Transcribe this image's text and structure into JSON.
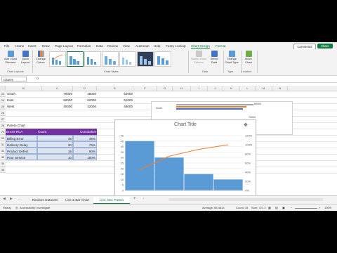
{
  "ribbon": {
    "tabs": [
      "File",
      "Home",
      "Insert",
      "Draw",
      "Page Layout",
      "Formulas",
      "Data",
      "Review",
      "View",
      "Automate",
      "Help",
      "Fuzzy Lookup",
      "Chart Design",
      "Format"
    ],
    "comments_label": "Comments",
    "share_label": "Share",
    "buttons": {
      "add_chart_element": "Add Chart Element",
      "quick_layout": "Quick Layout",
      "change_colors": "Change Colors",
      "switch_row_col": "Switch Row/ Column",
      "select_data": "Select Data",
      "change_chart_type": "Change Chart Type",
      "move_chart": "Move Chart"
    },
    "groups": {
      "chart_layouts": "Chart Layouts",
      "chart_styles": "Chart Styles",
      "data": "Data",
      "type": "Type",
      "location": "Location"
    }
  },
  "formula_bar": {
    "name_box": "Chart 5",
    "fx": "fx",
    "value": ""
  },
  "columns": [
    "B",
    "C",
    "D",
    "E",
    "F",
    "G",
    "H",
    "I",
    "J",
    "K",
    "L",
    "M",
    "N"
  ],
  "rows": {
    "numbers": [
      "23",
      "24",
      "25",
      "26",
      "27",
      "28",
      "29",
      "30",
      "31",
      "32",
      "33",
      "34",
      "35"
    ],
    "region_rows": [
      {
        "label": "South",
        "c": "70000",
        "d": "48000",
        "e": "52000"
      },
      {
        "label": "East",
        "c": "60000",
        "d": "62000",
        "e": "61000"
      },
      {
        "label": "West",
        "c": "40000",
        "d": "42000",
        "e": "48000"
      }
    ],
    "pareto_title": "Pareto Chart",
    "table_headers": {
      "col1": "Errors RCA",
      "col2": "Count",
      "col3": "Cumulative"
    },
    "table_rows": [
      {
        "label": "Billing Error",
        "count": "45",
        "cum": "45%"
      },
      {
        "label": "Delivery Delay",
        "count": "30",
        "cum": "75%"
      },
      {
        "label": "Product Defect",
        "count": "15",
        "cum": "90%"
      },
      {
        "label": "Poor Service",
        "count": "10",
        "cum": "100%"
      }
    ]
  },
  "background_chart": {
    "label_row": "North",
    "value": "60000",
    "axis_label": "70000"
  },
  "chart_data": {
    "type": "bar",
    "title": "Chart Title",
    "categories": [
      "Billing Error",
      "Delivery Delay",
      "Product Defect",
      "Poor Service"
    ],
    "series": [
      {
        "values": [
          45,
          30,
          15,
          10
        ]
      },
      {
        "type": "line",
        "values": [
          45,
          75,
          90,
          100
        ]
      }
    ],
    "y_left_ticks": [
      "50",
      "45",
      "40",
      "35",
      "30",
      "25",
      "20",
      "15",
      "10",
      "5",
      "0"
    ],
    "y_right_ticks": [
      "120%",
      "100%",
      "80%",
      "60%",
      "40%",
      "20%",
      "0%"
    ],
    "ylim": [
      0,
      50
    ],
    "y2lim": [
      0,
      120
    ],
    "colors": {
      "bar": "#5b9bd5",
      "line": "#ed7d31"
    }
  },
  "sheets": [
    "Random Datasets",
    "Line & Bar Chart",
    "Line, Bar, Pareto"
  ],
  "status": {
    "ready": "Ready",
    "accessibility": "Accessibility: Investigate",
    "average": "Average: 55.4813",
    "count": "Count: 15",
    "sum": "Sum: 721.3",
    "zoom": "100%"
  }
}
